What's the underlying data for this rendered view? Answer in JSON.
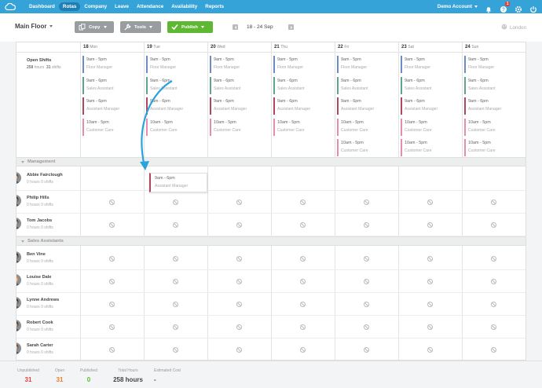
{
  "nav": {
    "items": [
      "Dashboard",
      "Rotas",
      "Company",
      "Leave",
      "Attendance",
      "Availability",
      "Reports"
    ],
    "active": "Rotas",
    "account": "Demo Account",
    "notification_count": "1"
  },
  "toolbar": {
    "location": "Main Floor",
    "copy_label": "Copy",
    "tools_label": "Tools",
    "publish_label": "Publish",
    "date_range": "18 - 24 Sep",
    "timezone": "London"
  },
  "days": [
    {
      "num": "18",
      "dow": "Mon"
    },
    {
      "num": "19",
      "dow": "Tue"
    },
    {
      "num": "20",
      "dow": "Wed"
    },
    {
      "num": "21",
      "dow": "Thu"
    },
    {
      "num": "22",
      "dow": "Fri"
    },
    {
      "num": "23",
      "dow": "Sat"
    },
    {
      "num": "24",
      "dow": "Sun"
    }
  ],
  "open_shifts": {
    "label": "Open Shifts",
    "hours": "258",
    "hours_unit": "hours",
    "shifts": "31",
    "shifts_unit": "shifts"
  },
  "shift_times": {
    "a": "9am - 5pm",
    "b": "9am - 6pm",
    "c": "10am - 5pm"
  },
  "roles": {
    "fm": "Floor Manager",
    "sa": "Sales Assistant",
    "am": "Assistant Manager",
    "cc": "Customer Care"
  },
  "colors": {
    "fm": "#6b8cc4",
    "sa": "#5fa58a",
    "am": "#b0475f",
    "cc": "#e88bb0",
    "accent": "#35a3d8",
    "arrow": "#2aa3dc",
    "publish": "#5fb832"
  },
  "open_shift_columns": [
    [
      {
        "time": "9am - 5pm",
        "role": "Floor Manager",
        "c": "fm"
      },
      {
        "time": "9am - 6pm",
        "role": "Sales Assistant",
        "c": "sa"
      },
      {
        "time": "9am - 6pm",
        "role": "Assistant Manager",
        "c": "am"
      },
      {
        "time": "10am - 5pm",
        "role": "Customer Care",
        "c": "cc"
      }
    ],
    [
      {
        "time": "9am - 5pm",
        "role": "Floor Manager",
        "c": "fm"
      },
      {
        "time": "9am - 6pm",
        "role": "Sales Assistant",
        "c": "sa"
      },
      {
        "time": "9am - 6pm",
        "role": "Assistant Manager",
        "c": "am"
      },
      {
        "time": "10am - 5pm",
        "role": "Customer Care",
        "c": "cc"
      }
    ],
    [
      {
        "time": "9am - 5pm",
        "role": "Floor Manager",
        "c": "fm"
      },
      {
        "time": "9am - 6pm",
        "role": "Sales Assistant",
        "c": "sa"
      },
      {
        "time": "9am - 6pm",
        "role": "Assistant Manager",
        "c": "am"
      },
      {
        "time": "10am - 5pm",
        "role": "Customer Care",
        "c": "cc"
      }
    ],
    [
      {
        "time": "9am - 5pm",
        "role": "Floor Manager",
        "c": "fm"
      },
      {
        "time": "9am - 6pm",
        "role": "Sales Assistant",
        "c": "sa"
      },
      {
        "time": "9am - 6pm",
        "role": "Assistant Manager",
        "c": "am"
      },
      {
        "time": "10am - 5pm",
        "role": "Customer Care",
        "c": "cc"
      }
    ],
    [
      {
        "time": "9am - 5pm",
        "role": "Floor Manager",
        "c": "fm"
      },
      {
        "time": "9am - 6pm",
        "role": "Sales Assistant",
        "c": "sa"
      },
      {
        "time": "9am - 6pm",
        "role": "Assistant Manager",
        "c": "am"
      },
      {
        "time": "10am - 5pm",
        "role": "Customer Care",
        "c": "cc"
      },
      {
        "time": "10am - 5pm",
        "role": "Customer Care",
        "c": "cc"
      }
    ],
    [
      {
        "time": "9am - 5pm",
        "role": "Floor Manager",
        "c": "fm"
      },
      {
        "time": "9am - 6pm",
        "role": "Sales Assistant",
        "c": "sa"
      },
      {
        "time": "9am - 6pm",
        "role": "Assistant Manager",
        "c": "am"
      },
      {
        "time": "10am - 5pm",
        "role": "Customer Care",
        "c": "cc"
      },
      {
        "time": "10am - 5pm",
        "role": "Customer Care",
        "c": "cc"
      }
    ],
    [
      {
        "time": "9am - 5pm",
        "role": "Floor Manager",
        "c": "fm"
      },
      {
        "time": "9am - 6pm",
        "role": "Sales Assistant",
        "c": "sa"
      },
      {
        "time": "9am - 6pm",
        "role": "Assistant Manager",
        "c": "am"
      },
      {
        "time": "10am - 5pm",
        "role": "Customer Care",
        "c": "cc"
      },
      {
        "time": "10am - 5pm",
        "role": "Customer Care",
        "c": "cc"
      }
    ]
  ],
  "dragged_shift": {
    "time": "9am - 6pm",
    "role": "Assistant Manager"
  },
  "groups": [
    {
      "name": "Management",
      "employees": [
        {
          "name": "Abbie Fairclough",
          "hours": "0",
          "shifts": "0"
        },
        {
          "name": "Philip Hills",
          "hours": "0",
          "shifts": "0"
        },
        {
          "name": "Tom Jacobs",
          "hours": "0",
          "shifts": "0"
        }
      ]
    },
    {
      "name": "Sales Assistants",
      "employees": [
        {
          "name": "Ben Vine",
          "hours": "0",
          "shifts": "0"
        },
        {
          "name": "Louise Dale",
          "hours": "0",
          "shifts": "0"
        },
        {
          "name": "Lynne Andrews",
          "hours": "0",
          "shifts": "0"
        },
        {
          "name": "Robert Cook",
          "hours": "0",
          "shifts": "0"
        },
        {
          "name": "Sarah Carter",
          "hours": "0",
          "shifts": "0"
        }
      ]
    }
  ],
  "footer": {
    "unpublished_label": "Unpublished",
    "unpublished": "31",
    "open_label": "Open",
    "open": "31",
    "published_label": "Published",
    "published": "0",
    "total_label": "Total Hours",
    "total": "258 hours",
    "cost_label": "Estimated Cost",
    "cost": "-"
  }
}
